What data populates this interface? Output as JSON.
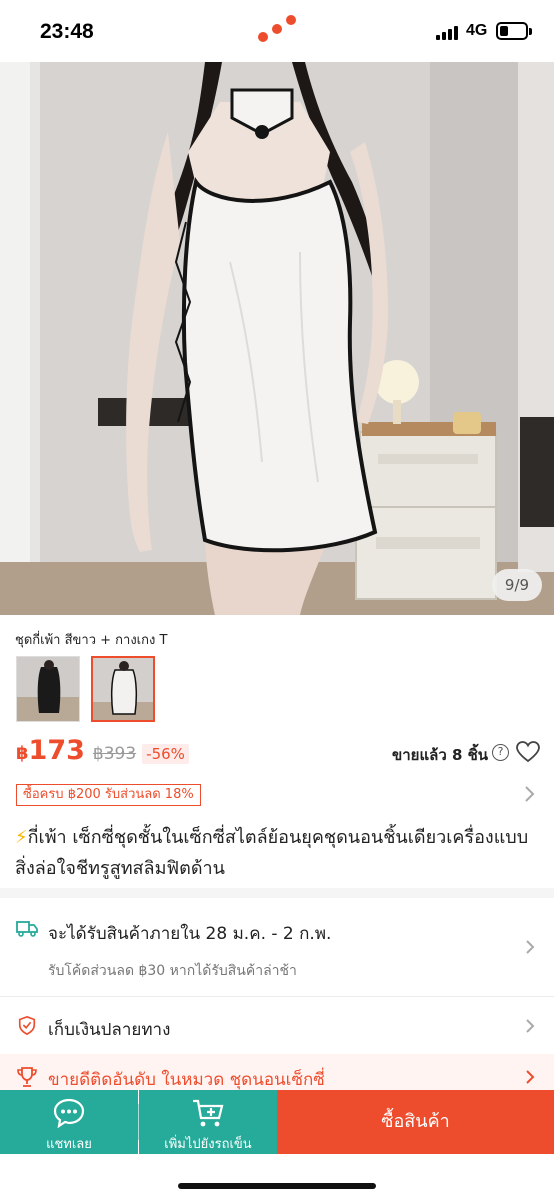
{
  "status_bar": {
    "time": "23:48",
    "network": "4G"
  },
  "gallery": {
    "counter": "9/9",
    "current": 9,
    "total": 9
  },
  "variant": {
    "name": "ชุดกี่เพ้า สีขาว + กางเกง T"
  },
  "price": {
    "currency": "฿",
    "current": "173",
    "original": "฿393",
    "discount": "-56%",
    "sold": "ขายแล้ว 8 ชิ้น"
  },
  "promo": {
    "label": "ซื้อครบ ฿200 รับส่วนลด 18%"
  },
  "product": {
    "bolt": "⚡",
    "title": "กี่เพ้า เซ็กซี่ชุดชั้นในเซ็กซี่สไตล์ย้อนยุคชุดนอนชิ้นเดียวเครื่องแบบสิ่งล่อใจชีทรูสูทสลิมฟิตด้าน"
  },
  "shipping": {
    "label": "จะได้รับสินค้าภายใน 28 ม.ค. - 2 ก.พ.",
    "sub": "รับโค้ดส่วนลด ฿30 หากได้รับสินค้าล่าช้า"
  },
  "cod": {
    "label": "เก็บเงินปลายทาง"
  },
  "bestseller": {
    "label": "ขายดีติดอันดับ ในหมวด ชุดนอนเซ็กซี่"
  },
  "bottom_bar": {
    "chat_label": "แชทเลย",
    "cart_label": "เพิ่มไปยังรถเข็น",
    "buy_label": "ซื้อสินค้า"
  },
  "colors": {
    "accent": "#ee4d2d",
    "teal": "#26aa99",
    "bolt": "#f6b800"
  }
}
